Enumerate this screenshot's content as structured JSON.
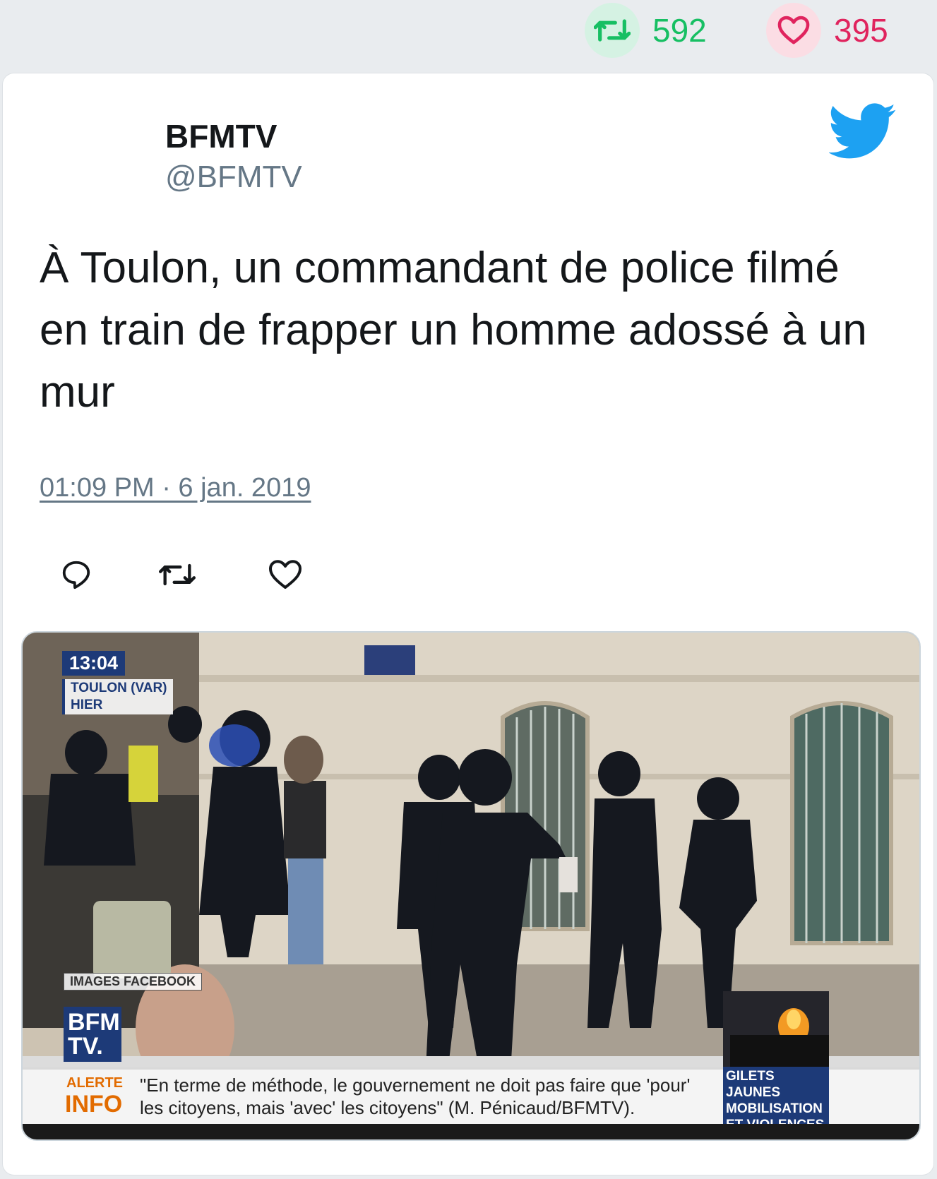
{
  "stats": {
    "retweets": "592",
    "likes": "395",
    "retweet_icon": "retweet-icon",
    "like_icon": "heart-icon"
  },
  "tweet": {
    "author_name": "BFMTV",
    "author_handle": "@BFMTV",
    "text": "À Toulon, un commandant de police filmé en train de frapper un homme adossé à un mur",
    "timestamp": "01:09 PM · 6 jan. 2019",
    "brand_icon": "twitter-bird-icon"
  },
  "actions": {
    "reply_icon": "reply-icon",
    "retweet_icon": "retweet-icon",
    "like_icon": "heart-icon"
  },
  "media": {
    "overlay_time": "13:04",
    "overlay_location_line1": "TOULON (VAR)",
    "overlay_location_line2": "HIER",
    "overlay_source": "IMAGES FACEBOOK",
    "logo_line1": "BFM",
    "logo_line2": "TV.",
    "ticker_alert": "ALERTE",
    "ticker_info": "INFO",
    "ticker_quote": "\"En terme de méthode, le gouvernement ne doit pas faire que 'pour' les citoyens, mais 'avec' les citoyens\" (M. Pénicaud/BFMTV).",
    "ticker_topic": "GILETS JAUNES MOBILISATION ET VIOLENCES"
  },
  "colors": {
    "page_bg": "#e9ecef",
    "retweet_green": "#17bf63",
    "like_red": "#e0245e",
    "twitter_blue": "#1da1f2",
    "muted_text": "#657786",
    "bfm_blue": "#1d3a78"
  }
}
